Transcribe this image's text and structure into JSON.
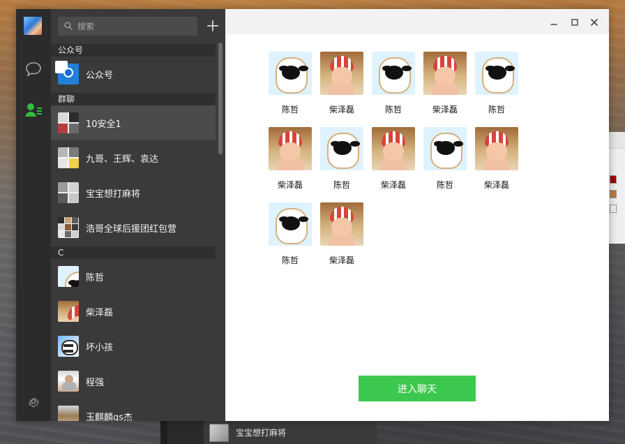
{
  "colors": {
    "nav_bg": "#2b2b2b",
    "list_bg": "#3a3a3a",
    "section_bg": "#2f2f2f",
    "selected_bg": "#4b4b4b",
    "accent_green": "#3cc84f",
    "content_bg": "#ffffff",
    "titlebar_bg": "#f2f2f2"
  },
  "search": {
    "placeholder": "搜索"
  },
  "sections": {
    "official": "公众号",
    "groups": "群聊",
    "c": "C"
  },
  "official_accounts": [
    {
      "name": "公众号"
    }
  ],
  "group_chats": [
    {
      "name": "10安全1"
    },
    {
      "name": "九哥、王辉、袁达"
    },
    {
      "name": "宝宝想打麻将"
    },
    {
      "name": "浩哥全球后援团红包营"
    }
  ],
  "contacts_c": [
    {
      "name": "陈哲"
    },
    {
      "name": "柴泽磊"
    },
    {
      "name": "坏小孩"
    },
    {
      "name": "程强"
    },
    {
      "name": "玉麒麟qs杰"
    }
  ],
  "group_members": [
    {
      "name": "陈哲"
    },
    {
      "name": "柴泽磊"
    },
    {
      "name": "陈哲"
    },
    {
      "name": "柴泽磊"
    },
    {
      "name": "陈哲"
    },
    {
      "name": "柴泽磊"
    },
    {
      "name": "陈哲"
    },
    {
      "name": "柴泽磊"
    },
    {
      "name": "陈哲"
    },
    {
      "name": "柴泽磊"
    },
    {
      "name": "陈哲"
    },
    {
      "name": "柴泽磊"
    }
  ],
  "actions": {
    "enter_chat": "进入聊天"
  },
  "behind_window": {
    "chat_preview": "宝宝想打麻将"
  }
}
